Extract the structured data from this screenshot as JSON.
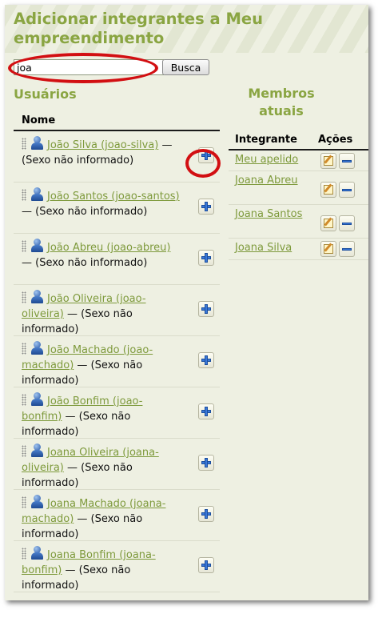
{
  "page": {
    "title": "Adicionar integrantes a Meu empreendimento"
  },
  "search": {
    "value": "joa",
    "button_label": "Busca"
  },
  "users": {
    "title": "Usuários",
    "column_header": "Nome",
    "rows": [
      {
        "link": "João Silva (joao-silva)",
        "suffix": " — (Sexo não informado)"
      },
      {
        "link": "João Santos (joao-santos)",
        "suffix": " — (Sexo não informado)"
      },
      {
        "link": "João Abreu (joao-abreu)",
        "suffix": " — (Sexo não informado)"
      },
      {
        "link": "João Oliveira (joao-oliveira)",
        "suffix": " — (Sexo não informado)"
      },
      {
        "link": "João Machado (joao-machado)",
        "suffix": " — (Sexo não informado)"
      },
      {
        "link": "João Bonfim (joao-bonfim)",
        "suffix": " — (Sexo não informado)"
      },
      {
        "link": "Joana Oliveira (joana-oliveira)",
        "suffix": " — (Sexo não informado)"
      },
      {
        "link": "Joana Machado (joana-machado)",
        "suffix": " — (Sexo não informado)"
      },
      {
        "link": "Joana Bonfim (joana-bonfim)",
        "suffix": " — (Sexo não informado)"
      }
    ]
  },
  "members": {
    "title": "Membros atuais",
    "column_member": "Integrante",
    "column_actions": "Ações",
    "rows": [
      {
        "name": "Meu apelido"
      },
      {
        "name": "Joana Abreu"
      },
      {
        "name": "Joana Santos"
      },
      {
        "name": "Joana Silva"
      }
    ]
  },
  "colors": {
    "accent": "#8aa542",
    "link": "#7e9a3c",
    "annotation": "#d20f12",
    "background": "#eef0e2"
  },
  "icons": {
    "user": "user-icon",
    "add": "plus-icon",
    "edit": "edit-icon",
    "remove": "minus-icon",
    "drag": "drag-handle-icon"
  }
}
